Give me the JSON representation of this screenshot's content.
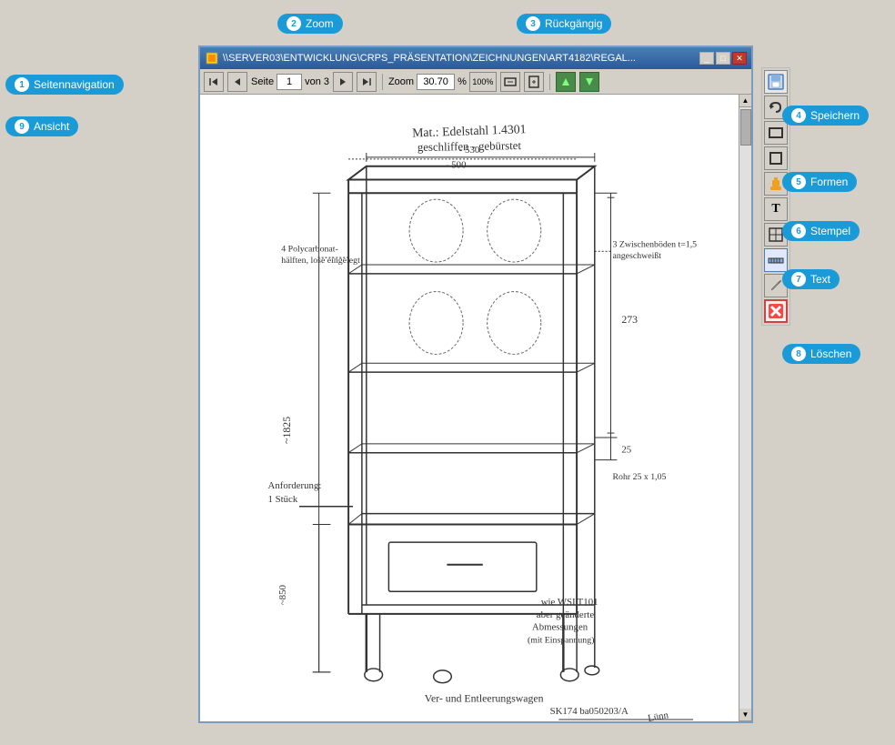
{
  "tooltips": {
    "zoom": {
      "label": "Zoom",
      "num": "2"
    },
    "rueckgaengig": {
      "label": "Rückgängig",
      "num": "3"
    },
    "seitennavigation": {
      "label": "Seitennavigation",
      "num": "1"
    },
    "ansicht": {
      "label": "Ansicht",
      "num": "9"
    },
    "speichern": {
      "label": "Speichern",
      "num": "4"
    },
    "formen": {
      "label": "Formen",
      "num": "5"
    },
    "stempel": {
      "label": "Stempel",
      "num": "6"
    },
    "text": {
      "label": "Text",
      "num": "7"
    },
    "loeschen": {
      "label": "Löschen",
      "num": "8"
    }
  },
  "window": {
    "title": "\\\\SERVER03\\ENTWICKLUNG\\CRPS_PRÄSENTATION\\ZEICHNUNGEN\\ART4182\\REGAL...",
    "page_current": "1",
    "page_total": "3",
    "zoom_value": "30.70",
    "zoom_unit": "%"
  },
  "toolbar": {
    "first_btn": "◀◀",
    "prev_btn": "◀",
    "next_btn": "▶",
    "last_btn": "▶▶",
    "page_label": "Seite",
    "von_label": "von",
    "zoom_100": "100%"
  },
  "right_panel": {
    "btn1_icon": "📁",
    "btn2_icon": "↩",
    "btn3_icon": "⬜",
    "btn4_icon": "⬜",
    "btn5_icon": "🔖",
    "btn6_icon": "T",
    "btn7_icon": "▦",
    "btn8_icon": "⊟",
    "btn9_icon": "✏",
    "btn10_icon": "❌"
  }
}
